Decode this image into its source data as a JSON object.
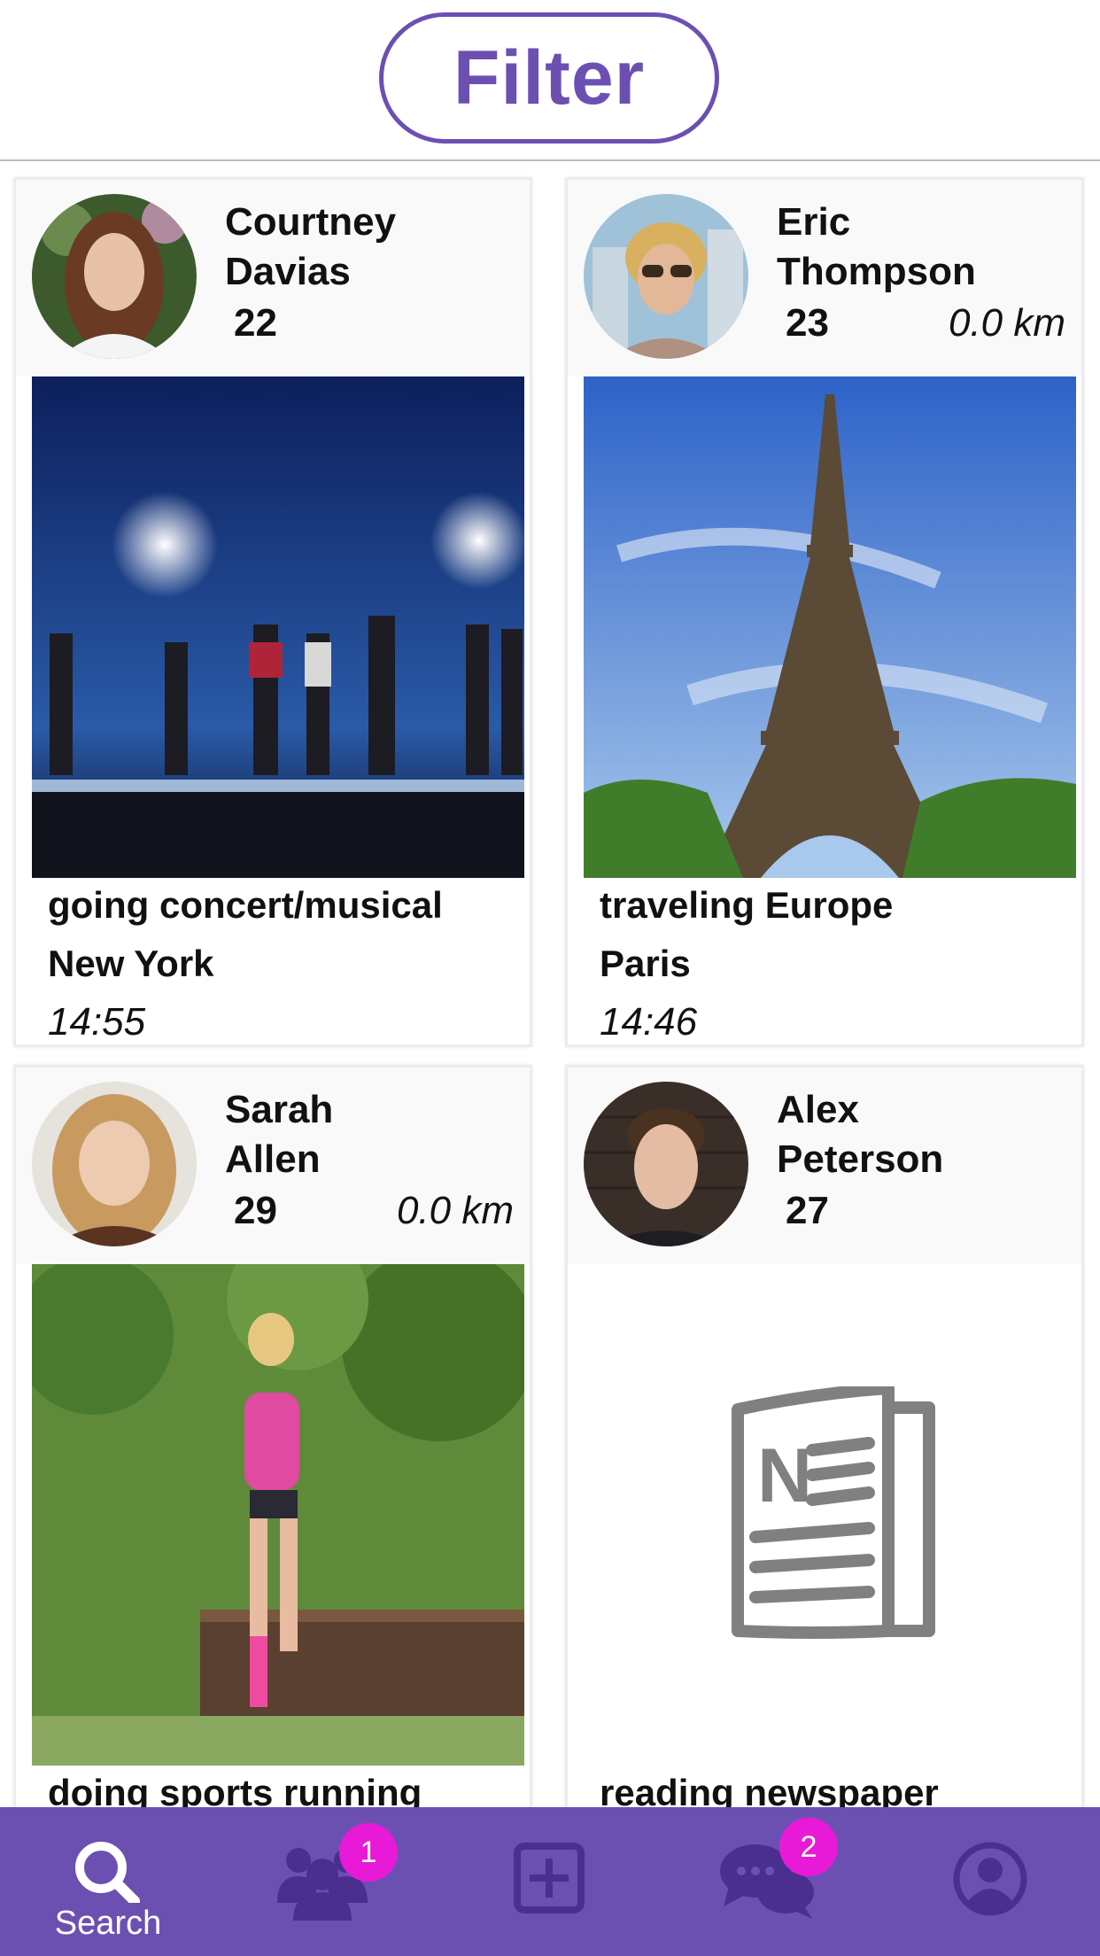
{
  "header": {
    "filter_label": "Filter"
  },
  "cards": [
    {
      "name_first": "Courtney",
      "name_last": "Davias",
      "age": "22",
      "distance": "",
      "activity": "going concert/musical",
      "place": "New York",
      "time": "14:55"
    },
    {
      "name_first": "Eric",
      "name_last": "Thompson",
      "age": "23",
      "distance": "0.0 km",
      "activity": "traveling Europe",
      "place": "Paris",
      "time": "14:46"
    },
    {
      "name_first": "Sarah",
      "name_last": "Allen",
      "age": "29",
      "distance": "0.0 km",
      "activity": "doing sports running",
      "place": "",
      "time": ""
    },
    {
      "name_first": "Alex",
      "name_last": "Peterson",
      "age": "27",
      "distance": "",
      "activity": "reading newspaper",
      "place": "",
      "time": ""
    }
  ],
  "tabbar": {
    "items": [
      {
        "icon": "search-icon",
        "label": "Search",
        "badge": ""
      },
      {
        "icon": "people-icon",
        "label": "",
        "badge": "1"
      },
      {
        "icon": "add-icon",
        "label": "",
        "badge": ""
      },
      {
        "icon": "chat-icon",
        "label": "",
        "badge": "2"
      },
      {
        "icon": "profile-icon",
        "label": "",
        "badge": ""
      }
    ]
  },
  "colors": {
    "accent": "#6b50b2",
    "badge": "#e81ad8",
    "card_header": "#f9f9fa"
  }
}
